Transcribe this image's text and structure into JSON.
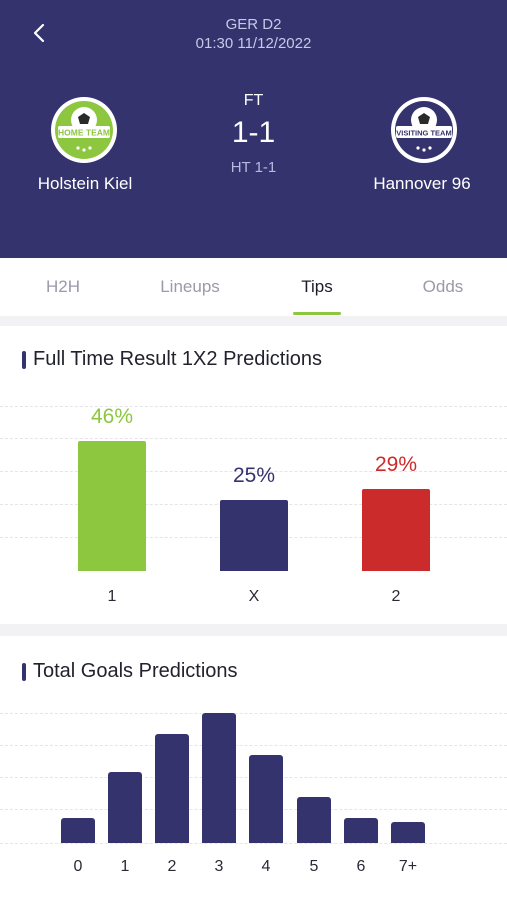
{
  "header": {
    "league": "GER D2",
    "datetime": "01:30 11/12/2022",
    "status": "FT",
    "score": "1-1",
    "halftime": "HT 1-1",
    "home_team": "Holstein Kiel",
    "away_team": "Hannover 96",
    "home_crest_text": "HOME TEAM",
    "away_crest_text": "VISITING TEAM"
  },
  "tabs": [
    {
      "label": "H2H"
    },
    {
      "label": "Lineups"
    },
    {
      "label": "Tips"
    },
    {
      "label": "Odds"
    }
  ],
  "active_tab": "Tips",
  "colors": {
    "header_bg": "#35336e",
    "accent_green": "#8dc63f",
    "navy": "#35336e",
    "red": "#cc2b2b"
  },
  "prediction_1x2": {
    "title": "Full Time Result 1X2 Predictions",
    "labels": [
      "1",
      "X",
      "2"
    ],
    "percent_labels": [
      "46%",
      "25%",
      "29%"
    ]
  },
  "goals": {
    "title": "Total Goals Predictions",
    "labels": [
      "0",
      "1",
      "2",
      "3",
      "4",
      "5",
      "6",
      "7+"
    ]
  },
  "chart_data": [
    {
      "type": "bar",
      "title": "Full Time Result 1X2 Predictions",
      "categories": [
        "1",
        "X",
        "2"
      ],
      "values": [
        46,
        25,
        29
      ],
      "colors": [
        "#8dc63f",
        "#35336e",
        "#cc2b2b"
      ],
      "grid": true
    },
    {
      "type": "bar",
      "title": "Total Goals Predictions",
      "categories": [
        "0",
        "1",
        "2",
        "3",
        "4",
        "5",
        "6",
        "7+"
      ],
      "values": [
        6,
        17,
        26,
        31,
        21,
        11,
        6,
        5
      ],
      "colors": [
        "#35336e"
      ],
      "grid": true
    }
  ]
}
